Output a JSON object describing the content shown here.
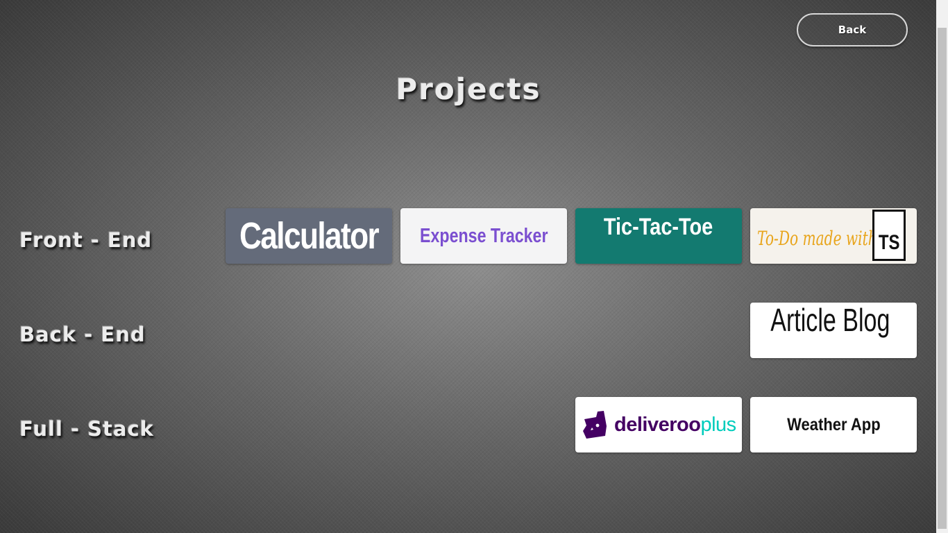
{
  "header": {
    "back_label": "Back",
    "title": "Projects"
  },
  "categories": {
    "front_end": "Front - End",
    "back_end": "Back - End",
    "full_stack": "Full - Stack"
  },
  "projects": {
    "front_end": {
      "calculator": "Calculator",
      "expense_tracker": "Expense Tracker",
      "tic_tac_toe": "Tic-Tac-Toe",
      "todo": "To-Do made with",
      "todo_badge": "TS"
    },
    "back_end": {
      "article_blog": "Article Blog"
    },
    "full_stack": {
      "deliveroo_part1": "deliveroo",
      "deliveroo_part2": "plus",
      "weather_app": "Weather App"
    }
  },
  "colors": {
    "calculator_bg": "#646b7a",
    "expense_text": "#7b4fd0",
    "tic_tac_toe_bg": "#137a70",
    "todo_text": "#e8a51c",
    "deliveroo_purple": "#440063",
    "deliveroo_teal": "#00ccbc"
  },
  "icons": {
    "deliveroo_logo": "kangaroo-logo-icon",
    "typescript_logo": "ts-badge-icon"
  }
}
